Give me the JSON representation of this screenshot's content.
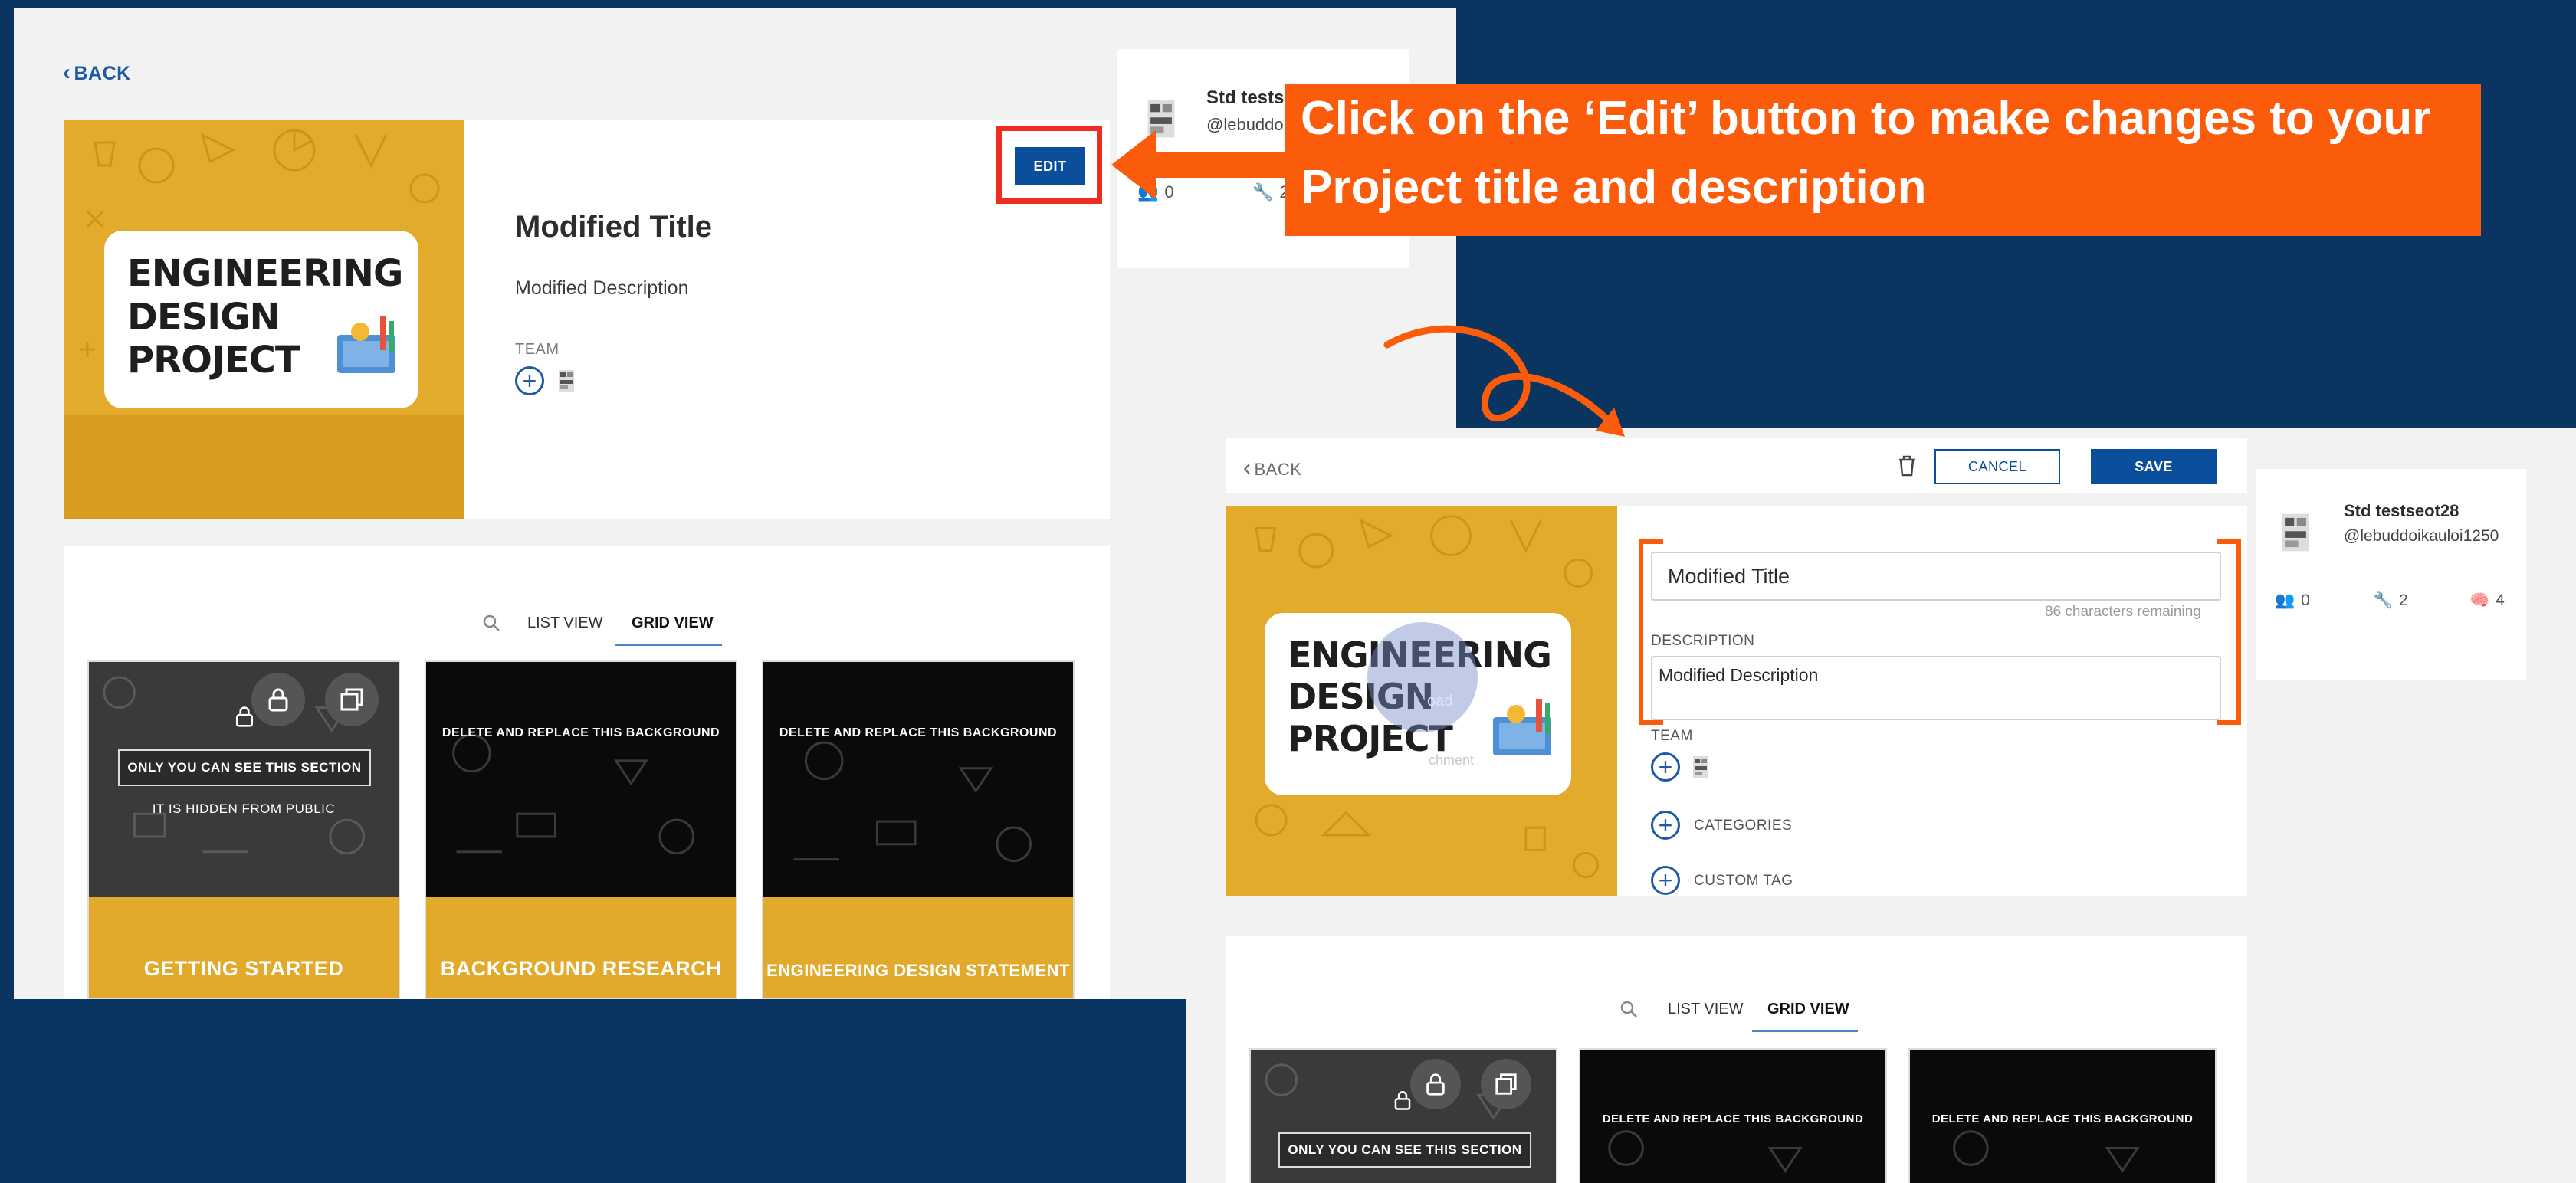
{
  "annotation": {
    "callout_text": "Click on the ‘Edit’ button to make changes to your Project title and description"
  },
  "left_screen": {
    "back_label": "BACK",
    "edit_label": "EDIT",
    "project_title": "Modified Title",
    "project_description": "Modified Description",
    "team_label": "TEAM",
    "cover_lines": [
      "ENGINEERING",
      "DESIGN",
      "PROJECT"
    ],
    "user": {
      "name": "Std tests",
      "handle": "@lebuddo",
      "followers": "0",
      "tools": "2"
    },
    "views": {
      "list": "LIST VIEW",
      "grid": "GRID VIEW"
    },
    "tiles": [
      {
        "private_box": "ONLY YOU CAN SEE THIS SECTION",
        "hidden": "IT IS HIDDEN FROM PUBLIC",
        "label": "GETTING STARTED"
      },
      {
        "top": "DELETE AND REPLACE THIS BACKGROUND",
        "label": "BACKGROUND RESEARCH"
      },
      {
        "top": "DELETE AND REPLACE THIS BACKGROUND",
        "label": "ENGINEERING DESIGN STATEMENT"
      }
    ]
  },
  "right_screen": {
    "back_label": "BACK",
    "cancel_label": "CANCEL",
    "save_label": "SAVE",
    "title_value": "Modified Title",
    "chars_remaining": "86 characters remaining",
    "description_label": "DESCRIPTION",
    "description_value": "Modified Description",
    "team_label": "TEAM",
    "categories_label": "CATEGORIES",
    "custom_tag_label": "CUSTOM TAG",
    "upload_label": "oad",
    "attachment_label": "chment",
    "cover_lines": [
      "ENGINEERING",
      "DESIGN",
      "PROJECT"
    ],
    "user": {
      "name": "Std testseot28",
      "handle": "@lebuddoikauloi1250",
      "followers": "0",
      "tools": "2",
      "likes": "4"
    },
    "views": {
      "list": "LIST VIEW",
      "grid": "GRID VIEW"
    },
    "tiles": [
      {
        "private_box": "ONLY YOU CAN SEE THIS SECTION"
      },
      {
        "top": "DELETE AND REPLACE THIS BACKGROUND"
      },
      {
        "top": "DELETE AND REPLACE THIS BACKGROUND"
      }
    ]
  },
  "colors": {
    "background": "#0a3560",
    "accent_orange": "#fa5c0c",
    "highlight_red": "#ee2c22",
    "primary_blue": "#0b4f9c",
    "cover_yellow": "#e3ab2c"
  },
  "icons": [
    "chevron-left-icon",
    "trash-icon",
    "plus-circle-icon",
    "search-icon",
    "lock-icon",
    "copy-icon",
    "users-icon",
    "wrench-icon",
    "brain-icon",
    "arrow-left-icon",
    "curved-arrow-icon"
  ]
}
